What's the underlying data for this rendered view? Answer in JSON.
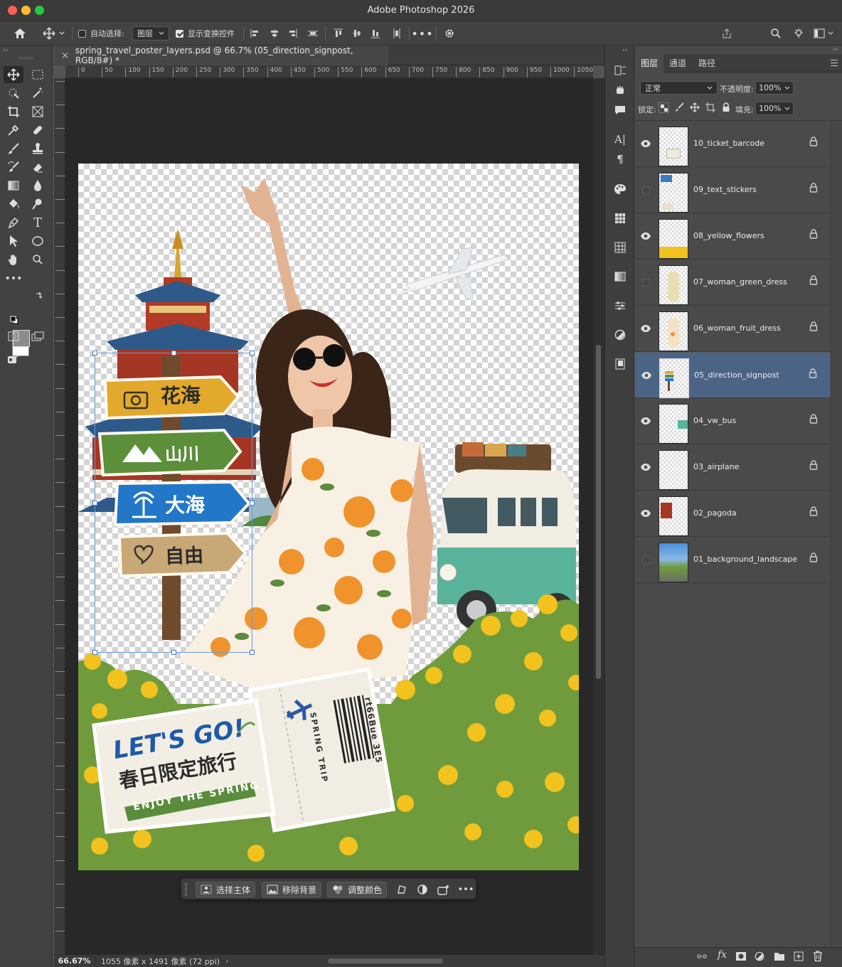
{
  "window": {
    "title": "Adobe Photoshop 2026"
  },
  "options": {
    "auto_select_label": "自动选择:",
    "auto_select_target": "图层",
    "show_transform_label": "显示变换控件"
  },
  "document": {
    "tab_title": "spring_travel_poster_layers.psd @ 66.7% (05_direction_signpost, RGB/8#) *"
  },
  "ruler": {
    "ticks": [
      "0",
      "50",
      "100",
      "150",
      "200",
      "250",
      "300",
      "350",
      "400",
      "450",
      "500",
      "550",
      "600",
      "650",
      "700",
      "750",
      "800",
      "850",
      "900",
      "950",
      "1000",
      "1050"
    ]
  },
  "status": {
    "zoom": "66.67%",
    "doc_info": "1055 像素 x 1491 像素 (72 ppi)",
    "arrow": "›"
  },
  "context_bar": {
    "select_subject": "选择主体",
    "remove_bg": "移除背景",
    "adjust_color": "调整颜色"
  },
  "poster": {
    "signs": [
      "花海",
      "山川",
      "大海",
      "自由"
    ],
    "lets_go": "LET'S GO!",
    "cn_slogan": "春日限定旅行",
    "enjoy": "ENJOY THE SPRING",
    "ticket_trip": "SPRING TRIP",
    "ticket_code": "rt66Bue 3E5"
  },
  "layers_panel": {
    "tabs": [
      "图层",
      "通道",
      "路径"
    ],
    "blend_mode": "正常",
    "opacity_label": "不透明度:",
    "opacity": "100%",
    "lock_label": "锁定:",
    "fill_label": "填充:",
    "fill": "100%",
    "layers": [
      {
        "name": "10_ticket_barcode",
        "visible": true,
        "selected": false
      },
      {
        "name": "09_text_stickers",
        "visible": false,
        "selected": false
      },
      {
        "name": "08_yellow_flowers",
        "visible": true,
        "selected": false
      },
      {
        "name": "07_woman_green_dress",
        "visible": false,
        "selected": false
      },
      {
        "name": "06_woman_fruit_dress",
        "visible": true,
        "selected": false
      },
      {
        "name": "05_direction_signpost",
        "visible": true,
        "selected": true
      },
      {
        "name": "04_vw_bus",
        "visible": true,
        "selected": false
      },
      {
        "name": "03_airplane",
        "visible": true,
        "selected": false
      },
      {
        "name": "02_pagoda",
        "visible": true,
        "selected": false
      },
      {
        "name": "01_background_landscape",
        "visible": false,
        "selected": false
      }
    ]
  },
  "colors": {
    "selected_layer": "#4b6486",
    "sign_yellow": "#e3a92c",
    "sign_green": "#5b8f3a",
    "sign_blue": "#2277c9",
    "sign_tan": "#c9a877",
    "flower": "#f2c21e"
  }
}
